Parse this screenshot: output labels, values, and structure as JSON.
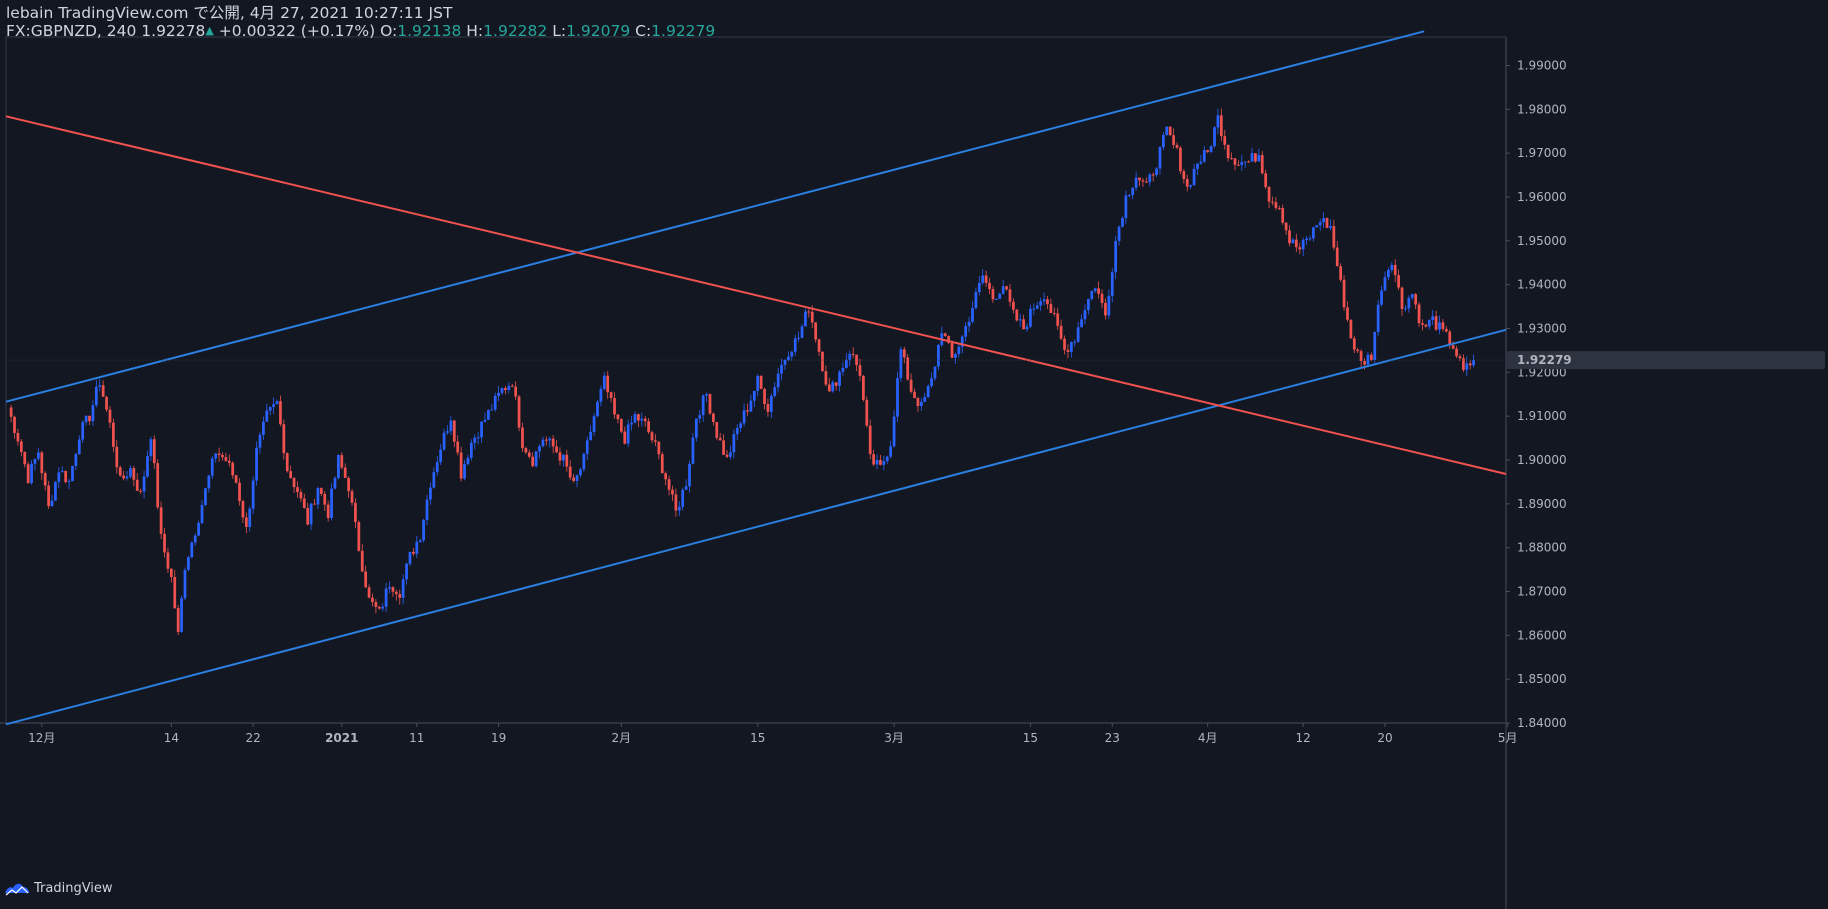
{
  "header": {
    "line1": "lebain TradingView.com で公開, 4月 27, 2021 10:27:11 JST",
    "symbol": "FX:GBPNZD, 240",
    "last": "1.92278",
    "change": "+0.00322 (+0.17%)",
    "o_label": "O:",
    "o_value": "1.92138",
    "h_label": "H:",
    "h_value": "1.92282",
    "l_label": "L:",
    "l_value": "1.92079",
    "c_label": "C:",
    "c_value": "1.92279"
  },
  "brand": {
    "name": "TradingView",
    "icon": "tradingview-logo-icon"
  },
  "colors": {
    "background": "#131722",
    "up": "#2962ff",
    "down": "#f0524f",
    "channel_line": "#2a7fe0",
    "trend_line": "#f0524f",
    "axis_text": "#b2b5be",
    "ohlc_value": "#26a69a",
    "price_badge_bg": "#2e3340"
  },
  "chart_data": {
    "type": "candlestick",
    "symbol": "FX:GBPNZD",
    "interval": "240",
    "ylim": [
      1.84,
      1.9965
    ],
    "y_ticks": [
      "1.99000",
      "1.98000",
      "1.97000",
      "1.96000",
      "1.95000",
      "1.94000",
      "1.93000",
      "1.92000",
      "1.91000",
      "1.90000",
      "1.89000",
      "1.88000",
      "1.87000",
      "1.86000",
      "1.85000",
      "1.84000"
    ],
    "current_price_label": "1.92279",
    "current_price": 1.92279,
    "x_ticks": [
      {
        "label": "12月",
        "bar": 10,
        "bold": false
      },
      {
        "label": "14",
        "bar": 48,
        "bold": false
      },
      {
        "label": "22",
        "bar": 72,
        "bold": false
      },
      {
        "label": "2021",
        "bar": 98,
        "bold": true
      },
      {
        "label": "11",
        "bar": 120,
        "bold": false
      },
      {
        "label": "19",
        "bar": 144,
        "bold": false
      },
      {
        "label": "2月",
        "bar": 180,
        "bold": false
      },
      {
        "label": "15",
        "bar": 220,
        "bold": false
      },
      {
        "label": "3月",
        "bar": 260,
        "bold": false
      },
      {
        "label": "15",
        "bar": 300,
        "bold": false
      },
      {
        "label": "23",
        "bar": 324,
        "bold": false
      },
      {
        "label": "4月",
        "bar": 352,
        "bold": false
      },
      {
        "label": "12",
        "bar": 380,
        "bold": false
      },
      {
        "label": "20",
        "bar": 404,
        "bold": false
      },
      {
        "label": "5月",
        "bar": 440,
        "bold": false
      }
    ],
    "bar_count": 440,
    "close_path": [
      [
        0,
        1.912
      ],
      [
        3,
        1.905
      ],
      [
        6,
        1.896
      ],
      [
        9,
        1.902
      ],
      [
        12,
        1.889
      ],
      [
        15,
        1.898
      ],
      [
        18,
        1.895
      ],
      [
        21,
        1.906
      ],
      [
        24,
        1.91
      ],
      [
        27,
        1.918
      ],
      [
        30,
        1.908
      ],
      [
        33,
        1.895
      ],
      [
        36,
        1.898
      ],
      [
        39,
        1.892
      ],
      [
        42,
        1.906
      ],
      [
        45,
        1.882
      ],
      [
        48,
        1.873
      ],
      [
        50,
        1.86
      ],
      [
        52,
        1.876
      ],
      [
        55,
        1.884
      ],
      [
        58,
        1.893
      ],
      [
        61,
        1.902
      ],
      [
        64,
        1.9
      ],
      [
        67,
        1.895
      ],
      [
        70,
        1.884
      ],
      [
        73,
        1.902
      ],
      [
        76,
        1.91
      ],
      [
        79,
        1.913
      ],
      [
        82,
        1.898
      ],
      [
        85,
        1.893
      ],
      [
        88,
        1.886
      ],
      [
        91,
        1.894
      ],
      [
        94,
        1.888
      ],
      [
        97,
        1.9
      ],
      [
        100,
        1.894
      ],
      [
        103,
        1.88
      ],
      [
        106,
        1.868
      ],
      [
        109,
        1.865
      ],
      [
        112,
        1.872
      ],
      [
        115,
        1.87
      ],
      [
        118,
        1.878
      ],
      [
        121,
        1.883
      ],
      [
        124,
        1.895
      ],
      [
        127,
        1.903
      ],
      [
        130,
        1.91
      ],
      [
        133,
        1.897
      ],
      [
        136,
        1.904
      ],
      [
        139,
        1.908
      ],
      [
        142,
        1.912
      ],
      [
        145,
        1.916
      ],
      [
        148,
        1.918
      ],
      [
        151,
        1.904
      ],
      [
        154,
        1.9
      ],
      [
        157,
        1.905
      ],
      [
        160,
        1.903
      ],
      [
        163,
        1.9
      ],
      [
        166,
        1.894
      ],
      [
        169,
        1.9
      ],
      [
        172,
        1.91
      ],
      [
        175,
        1.918
      ],
      [
        178,
        1.91
      ],
      [
        181,
        1.905
      ],
      [
        184,
        1.91
      ],
      [
        187,
        1.908
      ],
      [
        190,
        1.903
      ],
      [
        193,
        1.896
      ],
      [
        196,
        1.888
      ],
      [
        199,
        1.895
      ],
      [
        202,
        1.91
      ],
      [
        205,
        1.915
      ],
      [
        208,
        1.906
      ],
      [
        211,
        1.9
      ],
      [
        214,
        1.907
      ],
      [
        217,
        1.912
      ],
      [
        220,
        1.918
      ],
      [
        223,
        1.912
      ],
      [
        226,
        1.92
      ],
      [
        229,
        1.925
      ],
      [
        232,
        1.928
      ],
      [
        235,
        1.935
      ],
      [
        238,
        1.925
      ],
      [
        241,
        1.915
      ],
      [
        244,
        1.92
      ],
      [
        247,
        1.925
      ],
      [
        250,
        1.92
      ],
      [
        253,
        1.9
      ],
      [
        256,
        1.898
      ],
      [
        259,
        1.904
      ],
      [
        262,
        1.925
      ],
      [
        265,
        1.916
      ],
      [
        268,
        1.912
      ],
      [
        271,
        1.918
      ],
      [
        274,
        1.93
      ],
      [
        277,
        1.923
      ],
      [
        280,
        1.928
      ],
      [
        283,
        1.935
      ],
      [
        286,
        1.942
      ],
      [
        289,
        1.937
      ],
      [
        292,
        1.94
      ],
      [
        295,
        1.933
      ],
      [
        298,
        1.93
      ],
      [
        301,
        1.935
      ],
      [
        304,
        1.938
      ],
      [
        307,
        1.932
      ],
      [
        310,
        1.925
      ],
      [
        313,
        1.928
      ],
      [
        316,
        1.935
      ],
      [
        319,
        1.94
      ],
      [
        322,
        1.933
      ],
      [
        325,
        1.95
      ],
      [
        328,
        1.96
      ],
      [
        331,
        1.965
      ],
      [
        334,
        1.962
      ],
      [
        337,
        1.968
      ],
      [
        340,
        1.975
      ],
      [
        343,
        1.97
      ],
      [
        346,
        1.962
      ],
      [
        349,
        1.968
      ],
      [
        352,
        1.97
      ],
      [
        355,
        1.978
      ],
      [
        358,
        1.97
      ],
      [
        361,
        1.968
      ],
      [
        364,
        1.968
      ],
      [
        367,
        1.97
      ],
      [
        370,
        1.96
      ],
      [
        373,
        1.958
      ],
      [
        376,
        1.95
      ],
      [
        379,
        1.948
      ],
      [
        382,
        1.951
      ],
      [
        385,
        1.955
      ],
      [
        388,
        1.953
      ],
      [
        391,
        1.94
      ],
      [
        394,
        1.928
      ],
      [
        397,
        1.922
      ],
      [
        400,
        1.924
      ],
      [
        403,
        1.94
      ],
      [
        406,
        1.946
      ],
      [
        409,
        1.935
      ],
      [
        412,
        1.938
      ],
      [
        415,
        1.93
      ],
      [
        418,
        1.932
      ],
      [
        421,
        1.929
      ],
      [
        424,
        1.926
      ],
      [
        427,
        1.92
      ],
      [
        430,
        1.9228
      ]
    ],
    "drawings": [
      {
        "name": "upper-channel-line",
        "color": "#2a7fe0",
        "from": [
          0,
          1.9133
        ],
        "to": [
          416,
          1.9978
        ]
      },
      {
        "name": "lower-channel-line",
        "color": "#2a7fe0",
        "from": [
          0,
          1.8397
        ],
        "to": [
          440,
          1.9297
        ]
      },
      {
        "name": "descending-trend-line",
        "color": "#f0524f",
        "from": [
          0,
          1.9784
        ],
        "to": [
          440,
          1.8968
        ]
      }
    ]
  }
}
